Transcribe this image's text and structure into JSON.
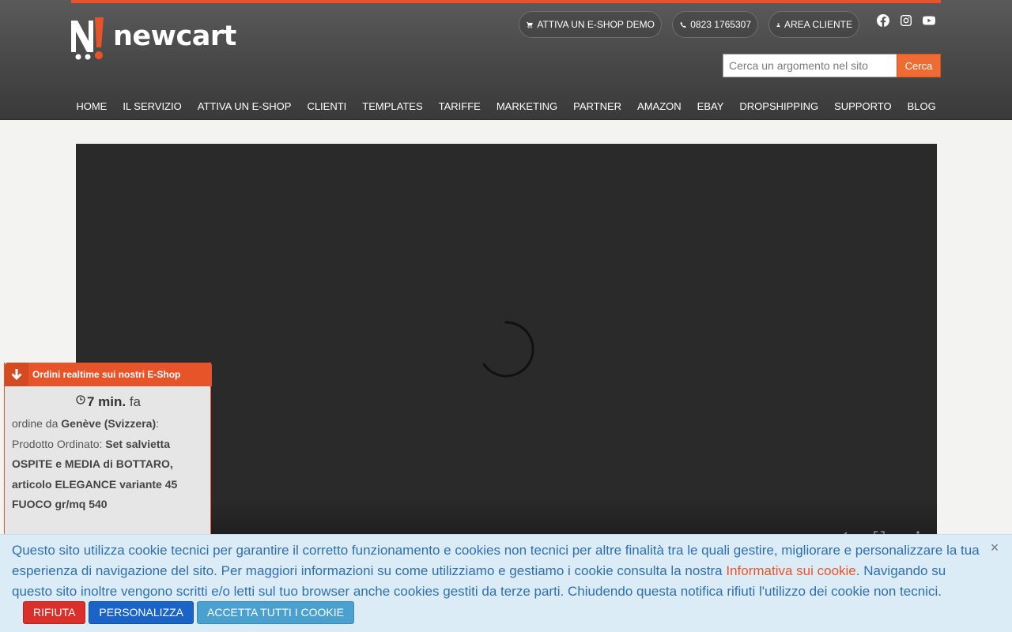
{
  "brand": {
    "name": "newcart",
    "accent_color": "#e8542a"
  },
  "header": {
    "links": [
      {
        "label": "ATTIVA UN E-SHOP DEMO",
        "icon": "cart-icon"
      },
      {
        "label": "0823 1765307",
        "icon": "phone-icon"
      },
      {
        "label": "AREA CLIENTE",
        "icon": "user-icon"
      }
    ],
    "social": [
      "facebook-icon",
      "instagram-icon",
      "youtube-icon"
    ],
    "search": {
      "placeholder": "Cerca un argomento nel sito",
      "value": "",
      "button_label": "Cerca"
    }
  },
  "nav": {
    "items": [
      "HOME",
      "IL SERVIZIO",
      "ATTIVA UN E-SHOP",
      "CLIENTI",
      "TEMPLATES",
      "TARIFFE",
      "MARKETING",
      "PARTNER",
      "AMAZON",
      "EBAY",
      "DROPSHIPPING",
      "SUPPORTO",
      "BLOG"
    ]
  },
  "video": {
    "state": "loading",
    "controls": [
      "autoplay-toggle-icon",
      "fullscreen-icon",
      "more-options-icon"
    ]
  },
  "orders_widget": {
    "title": "Ordini realtime sui nostri E-Shop",
    "time_value": "7 min.",
    "time_suffix": "fa",
    "origin_prefix": "ordine da",
    "origin": "Genève (Svizzera)",
    "origin_suffix": ":",
    "product_prefix": "Prodotto Ordinato:",
    "product": "Set salvietta OSPITE e MEDIA di BOTTARO, articolo ELEGANCE variante 45 FUOCO gr/mq 540"
  },
  "cookie_banner": {
    "text_before_link": "Questo sito utilizza cookie tecnici per garantire il corretto funzionamento e cookies non tecnici per altre finalità tra le quali gestire, migliorare e personalizzare la tua esperienza di navigazione del sito. Per maggiori informazioni su come utilizziamo e gestiamo i cookie consulta la nostra ",
    "link_label": "Informativa sui cookie",
    "text_after_link": ". Navigando su questo sito inoltre vengono scritti e/o letti sul tuo browser anche cookies gestiti da terze parti. Chiudendo questa notifica rifiuti l'utilizzo dei cookie non tecnici.",
    "reject_label": "RIFIUTA",
    "customize_label": "PERSONALIZZA",
    "accept_label": "ACCETTA TUTTI I COOKIE",
    "close_symbol": "×"
  }
}
